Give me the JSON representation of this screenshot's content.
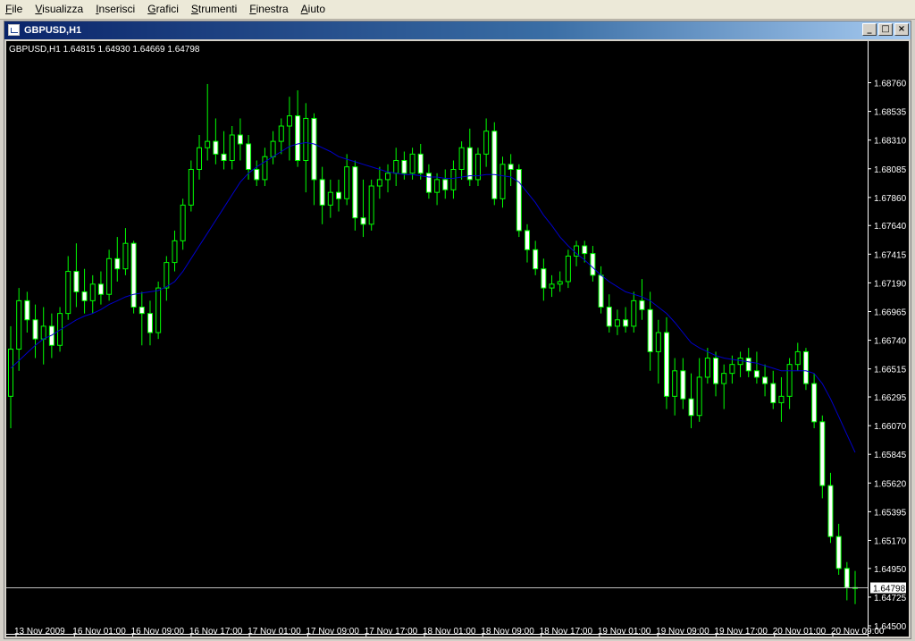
{
  "menu": {
    "items": [
      {
        "label": "File",
        "accel": "F",
        "rest": "ile"
      },
      {
        "label": "Visualizza",
        "accel": "V",
        "rest": "isualizza"
      },
      {
        "label": "Inserisci",
        "accel": "I",
        "rest": "nserisci"
      },
      {
        "label": "Grafici",
        "accel": "G",
        "rest": "rafici"
      },
      {
        "label": "Strumenti",
        "accel": "S",
        "rest": "trumenti"
      },
      {
        "label": "Finestra",
        "accel": "F",
        "rest": "inestra"
      },
      {
        "label": "Aiuto",
        "accel": "A",
        "rest": "iuto"
      }
    ]
  },
  "window": {
    "title": "GBPUSD,H1",
    "buttons": {
      "minimize": "_",
      "maximize": "□",
      "close": "×"
    }
  },
  "chart_data": {
    "type": "candlestick",
    "symbol": "GBPUSD",
    "timeframe": "H1",
    "info_line": "GBPUSD,H1  1.64815 1.64930 1.64669 1.64798",
    "ohlc_last": {
      "open": 1.64815,
      "high": 1.6493,
      "low": 1.64669,
      "close": 1.64798
    },
    "current_price": "1.64798",
    "ylim": [
      1.645,
      1.6896
    ],
    "y_ticks": [
      "1.68760",
      "1.68535",
      "1.68310",
      "1.68085",
      "1.67860",
      "1.67640",
      "1.67415",
      "1.67190",
      "1.66965",
      "1.66740",
      "1.66515",
      "1.66295",
      "1.66070",
      "1.65845",
      "1.65620",
      "1.65395",
      "1.65170",
      "1.64950",
      "1.64725",
      "1.64500"
    ],
    "x_ticks": [
      "13 Nov 2009",
      "16 Nov 01:00",
      "16 Nov 09:00",
      "16 Nov 17:00",
      "17 Nov 01:00",
      "17 Nov 09:00",
      "17 Nov 17:00",
      "18 Nov 01:00",
      "18 Nov 09:00",
      "18 Nov 17:00",
      "19 Nov 01:00",
      "19 Nov 09:00",
      "19 Nov 17:00",
      "20 Nov 01:00",
      "20 Nov 09:00"
    ],
    "colors": {
      "background": "#000000",
      "bull_candle": "#000000",
      "bear_candle": "#ffffff",
      "candle_outline": "#00ff00",
      "moving_average": "#0000cc",
      "axis_text": "#ffffff",
      "price_line": "#c0c0c0",
      "price_label_bg": "#ffffff",
      "price_label_text": "#000000"
    },
    "candles": [
      [
        1.663,
        1.6685,
        1.6605,
        1.6667
      ],
      [
        1.6667,
        1.6715,
        1.665,
        1.6705
      ],
      [
        1.6705,
        1.6712,
        1.668,
        1.669
      ],
      [
        1.669,
        1.6702,
        1.666,
        1.6675
      ],
      [
        1.6675,
        1.67,
        1.6655,
        1.6685
      ],
      [
        1.6685,
        1.6695,
        1.666,
        1.667
      ],
      [
        1.667,
        1.67,
        1.6665,
        1.6695
      ],
      [
        1.6695,
        1.674,
        1.669,
        1.6728
      ],
      [
        1.6728,
        1.675,
        1.67,
        1.6712
      ],
      [
        1.6712,
        1.673,
        1.6695,
        1.6705
      ],
      [
        1.6705,
        1.6725,
        1.6695,
        1.6718
      ],
      [
        1.6718,
        1.6728,
        1.6702,
        1.671
      ],
      [
        1.671,
        1.6745,
        1.6705,
        1.6738
      ],
      [
        1.6738,
        1.6755,
        1.672,
        1.673
      ],
      [
        1.673,
        1.6762,
        1.6725,
        1.675
      ],
      [
        1.675,
        1.6752,
        1.6695,
        1.67
      ],
      [
        1.67,
        1.6712,
        1.667,
        1.6695
      ],
      [
        1.6695,
        1.6705,
        1.667,
        1.668
      ],
      [
        1.668,
        1.672,
        1.6675,
        1.6715
      ],
      [
        1.6715,
        1.674,
        1.6705,
        1.6735
      ],
      [
        1.6735,
        1.676,
        1.6728,
        1.6752
      ],
      [
        1.6752,
        1.6785,
        1.6745,
        1.678
      ],
      [
        1.678,
        1.6815,
        1.6775,
        1.6808
      ],
      [
        1.6808,
        1.6835,
        1.68,
        1.6825
      ],
      [
        1.6825,
        1.6875,
        1.6815,
        1.683
      ],
      [
        1.683,
        1.6848,
        1.6812,
        1.682
      ],
      [
        1.682,
        1.6838,
        1.6808,
        1.6815
      ],
      [
        1.6815,
        1.6842,
        1.6808,
        1.6835
      ],
      [
        1.6835,
        1.6848,
        1.6815,
        1.6828
      ],
      [
        1.6828,
        1.6835,
        1.68,
        1.6808
      ],
      [
        1.6808,
        1.6815,
        1.6795,
        1.68
      ],
      [
        1.68,
        1.6825,
        1.6795,
        1.6818
      ],
      [
        1.6818,
        1.6838,
        1.6812,
        1.683
      ],
      [
        1.683,
        1.6848,
        1.682,
        1.6842
      ],
      [
        1.6842,
        1.6865,
        1.6815,
        1.685
      ],
      [
        1.685,
        1.687,
        1.681,
        1.6815
      ],
      [
        1.6815,
        1.686,
        1.679,
        1.6848
      ],
      [
        1.6848,
        1.6852,
        1.678,
        1.68
      ],
      [
        1.68,
        1.681,
        1.6765,
        1.678
      ],
      [
        1.678,
        1.68,
        1.677,
        1.679
      ],
      [
        1.679,
        1.68,
        1.6775,
        1.6785
      ],
      [
        1.6785,
        1.682,
        1.678,
        1.681
      ],
      [
        1.681,
        1.6815,
        1.676,
        1.677
      ],
      [
        1.677,
        1.68,
        1.6755,
        1.6765
      ],
      [
        1.6765,
        1.68,
        1.676,
        1.6795
      ],
      [
        1.6795,
        1.681,
        1.6785,
        1.68
      ],
      [
        1.68,
        1.6812,
        1.679,
        1.6805
      ],
      [
        1.6805,
        1.6825,
        1.6795,
        1.6815
      ],
      [
        1.6815,
        1.6822,
        1.68,
        1.6805
      ],
      [
        1.6805,
        1.6825,
        1.68,
        1.682
      ],
      [
        1.682,
        1.6828,
        1.68,
        1.6805
      ],
      [
        1.6805,
        1.6812,
        1.6785,
        1.679
      ],
      [
        1.679,
        1.6805,
        1.678,
        1.68
      ],
      [
        1.68,
        1.6808,
        1.6785,
        1.6792
      ],
      [
        1.6792,
        1.6815,
        1.6785,
        1.6808
      ],
      [
        1.6808,
        1.683,
        1.68,
        1.6825
      ],
      [
        1.6825,
        1.684,
        1.6795,
        1.68
      ],
      [
        1.68,
        1.6825,
        1.6795,
        1.682
      ],
      [
        1.682,
        1.6848,
        1.681,
        1.6838
      ],
      [
        1.6838,
        1.6845,
        1.678,
        1.6785
      ],
      [
        1.6785,
        1.6818,
        1.6778,
        1.6812
      ],
      [
        1.6812,
        1.682,
        1.6795,
        1.6808
      ],
      [
        1.6808,
        1.6812,
        1.6755,
        1.676
      ],
      [
        1.676,
        1.6765,
        1.6735,
        1.6745
      ],
      [
        1.6745,
        1.6752,
        1.6725,
        1.673
      ],
      [
        1.673,
        1.6738,
        1.6705,
        1.6715
      ],
      [
        1.6715,
        1.6725,
        1.6708,
        1.6718
      ],
      [
        1.6718,
        1.6728,
        1.6712,
        1.672
      ],
      [
        1.672,
        1.6745,
        1.6715,
        1.674
      ],
      [
        1.674,
        1.6752,
        1.6732,
        1.6748
      ],
      [
        1.6748,
        1.6752,
        1.6735,
        1.6742
      ],
      [
        1.6742,
        1.6748,
        1.672,
        1.6725
      ],
      [
        1.6725,
        1.6732,
        1.6695,
        1.67
      ],
      [
        1.67,
        1.671,
        1.668,
        1.6685
      ],
      [
        1.6685,
        1.6698,
        1.6678,
        1.669
      ],
      [
        1.669,
        1.67,
        1.668,
        1.6685
      ],
      [
        1.6685,
        1.6712,
        1.668,
        1.6705
      ],
      [
        1.6705,
        1.6722,
        1.669,
        1.6698
      ],
      [
        1.6698,
        1.6712,
        1.665,
        1.6665
      ],
      [
        1.6665,
        1.669,
        1.664,
        1.668
      ],
      [
        1.668,
        1.6692,
        1.662,
        1.663
      ],
      [
        1.663,
        1.666,
        1.6615,
        1.665
      ],
      [
        1.665,
        1.666,
        1.662,
        1.6628
      ],
      [
        1.6628,
        1.6648,
        1.6605,
        1.6615
      ],
      [
        1.6615,
        1.666,
        1.661,
        1.6645
      ],
      [
        1.6645,
        1.6668,
        1.664,
        1.666
      ],
      [
        1.666,
        1.6665,
        1.663,
        1.664
      ],
      [
        1.664,
        1.6655,
        1.662,
        1.6648
      ],
      [
        1.6648,
        1.6662,
        1.664,
        1.6655
      ],
      [
        1.6655,
        1.6665,
        1.6645,
        1.666
      ],
      [
        1.666,
        1.6668,
        1.6645,
        1.665
      ],
      [
        1.665,
        1.6665,
        1.664,
        1.6645
      ],
      [
        1.6645,
        1.6655,
        1.663,
        1.664
      ],
      [
        1.664,
        1.665,
        1.662,
        1.6625
      ],
      [
        1.6625,
        1.6645,
        1.661,
        1.663
      ],
      [
        1.663,
        1.666,
        1.662,
        1.6655
      ],
      [
        1.6655,
        1.6672,
        1.665,
        1.6665
      ],
      [
        1.6665,
        1.6668,
        1.6635,
        1.664
      ],
      [
        1.664,
        1.6648,
        1.6605,
        1.661
      ],
      [
        1.661,
        1.6615,
        1.655,
        1.656
      ],
      [
        1.656,
        1.657,
        1.6515,
        1.652
      ],
      [
        1.652,
        1.653,
        1.649,
        1.6495
      ],
      [
        1.6495,
        1.65,
        1.647,
        1.648
      ],
      [
        1.648,
        1.6493,
        1.6467,
        1.648
      ]
    ],
    "moving_average": [
      1.6652,
      1.6658,
      1.6664,
      1.667,
      1.6675,
      1.6678,
      1.6682,
      1.6686,
      1.669,
      1.6693,
      1.6695,
      1.6698,
      1.6702,
      1.6705,
      1.6708,
      1.671,
      1.6711,
      1.6712,
      1.6713,
      1.6716,
      1.672,
      1.6728,
      1.6738,
      1.6748,
      1.6758,
      1.6768,
      1.6778,
      1.6788,
      1.6798,
      1.6805,
      1.681,
      1.6814,
      1.6818,
      1.6822,
      1.6826,
      1.6828,
      1.6829,
      1.6828,
      1.6825,
      1.6822,
      1.6818,
      1.6816,
      1.6814,
      1.6812,
      1.681,
      1.6808,
      1.6806,
      1.6805,
      1.6804,
      1.6804,
      1.6803,
      1.6802,
      1.6802,
      1.6801,
      1.6801,
      1.6802,
      1.6803,
      1.6803,
      1.6804,
      1.6804,
      1.6803,
      1.6802,
      1.6798,
      1.679,
      1.6782,
      1.6772,
      1.6764,
      1.6755,
      1.6748,
      1.6742,
      1.6737,
      1.6731,
      1.6725,
      1.672,
      1.6716,
      1.6712,
      1.671,
      1.6708,
      1.6705,
      1.67,
      1.6695,
      1.6688,
      1.668,
      1.6672,
      1.6668,
      1.6665,
      1.6662,
      1.666,
      1.6659,
      1.6658,
      1.6657,
      1.6656,
      1.6654,
      1.6652,
      1.665,
      1.665,
      1.665,
      1.665,
      1.6648,
      1.664,
      1.6628,
      1.6614,
      1.66,
      1.6586
    ],
    "grid": false,
    "legend": "none"
  }
}
